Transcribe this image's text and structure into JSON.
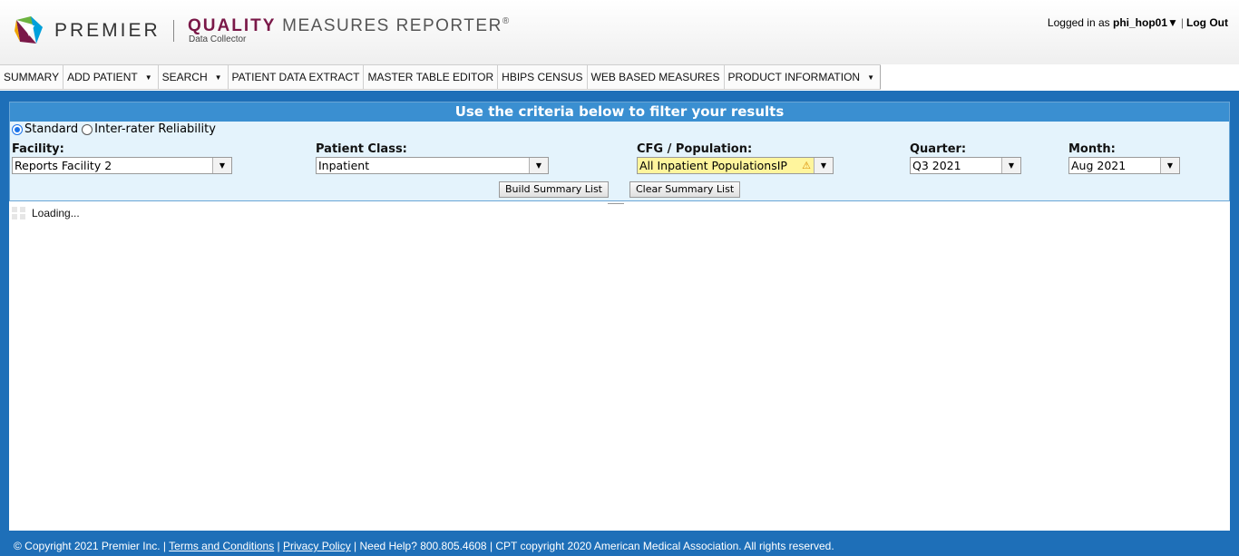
{
  "header": {
    "brand": "PREMIER",
    "product_strong": "QUALITY",
    "product_rest": " MEASURES REPORTER",
    "product_reg": "®",
    "product_sub": "Data Collector",
    "user_prefix": "Logged in as ",
    "username": "phi_hop01",
    "user_caret": "▼",
    "separator": "|",
    "logout": "Log Out",
    "brand_colors": [
      "#6cb33f",
      "#00a0dc",
      "#7a1848",
      "#f0a500"
    ]
  },
  "nav": {
    "items": [
      {
        "label": "SUMMARY",
        "caret": ""
      },
      {
        "label": "ADD PATIENT",
        "caret": "▼"
      },
      {
        "label": "SEARCH",
        "caret": "▼"
      },
      {
        "label": "PATIENT DATA EXTRACT",
        "caret": ""
      },
      {
        "label": "MASTER TABLE EDITOR",
        "caret": ""
      },
      {
        "label": "HBIPS CENSUS",
        "caret": ""
      },
      {
        "label": "WEB BASED MEASURES",
        "caret": ""
      },
      {
        "label": "PRODUCT INFORMATION",
        "caret": "▼"
      }
    ]
  },
  "filter": {
    "title": "Use the criteria below to filter your results",
    "radio_standard": "Standard",
    "radio_irr": "Inter-rater Reliability",
    "selected_mode": "Standard",
    "facility_label": "Facility:",
    "facility_value": "Reports Facility 2",
    "patient_class_label": "Patient Class:",
    "patient_class_value": "Inpatient",
    "cfg_label": "CFG / Population:",
    "cfg_value": "All Inpatient PopulationsIP",
    "cfg_warning": "⚠",
    "quarter_label": "Quarter:",
    "quarter_value": "Q3 2021",
    "month_label": "Month:",
    "month_value": "Aug 2021",
    "dropdown_arrow": "▼",
    "build_button": "Build Summary List",
    "clear_button": "Clear Summary List"
  },
  "content": {
    "loading_text": "Loading..."
  },
  "footer": {
    "copyright": "© Copyright 2021 Premier Inc.  | ",
    "terms": "Terms and Conditions",
    "sep1": " | ",
    "privacy": "Privacy Policy",
    "help": " | Need Help? 800.805.4608 | CPT copyright 2020 American Medical Association. All rights reserved."
  },
  "colors": {
    "frame_blue": "#1e6fb8",
    "panel_title_blue": "#3a8fd1",
    "panel_bg": "#e4f3fc",
    "highlight_yellow": "#fff59d"
  }
}
